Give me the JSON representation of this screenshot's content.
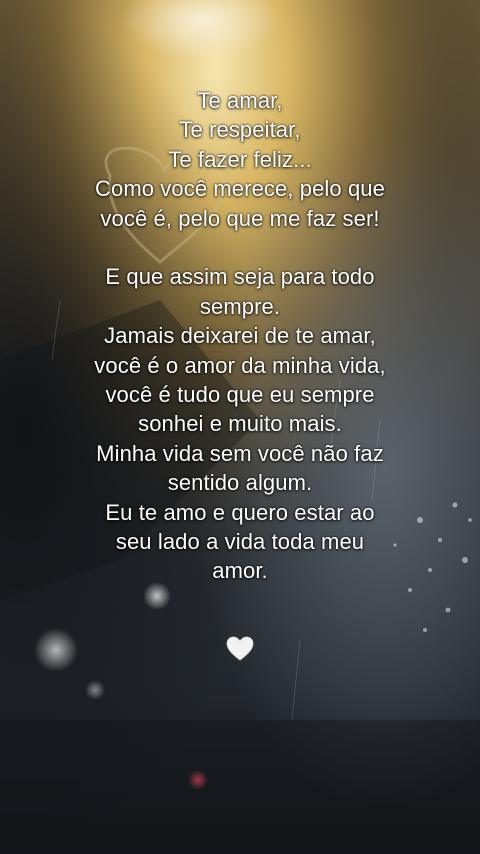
{
  "background": {
    "description_colors": {
      "warm_light": "#e9c873",
      "mid_amber": "#8a6d3a",
      "dark": "#1c1f24",
      "steel": "#5d6a78"
    }
  },
  "poem": {
    "stanza1": [
      "Te amar,",
      "Te respeitar,",
      "Te fazer feliz...",
      "Como você merece, pelo que",
      "você é, pelo que me faz ser!"
    ],
    "stanza2": [
      "E que assim seja para todo",
      "sempre.",
      "Jamais deixarei de te amar,",
      "você é o amor da minha vida,",
      "você é tudo que eu sempre",
      "sonhei e muito mais.",
      "Minha vida sem você não faz",
      "sentido algum.",
      "Eu te amo e quero estar ao",
      "seu lado a vida toda meu",
      "amor."
    ]
  },
  "emoji": {
    "name": "white-heart-icon",
    "color": "#f2f2f2"
  }
}
